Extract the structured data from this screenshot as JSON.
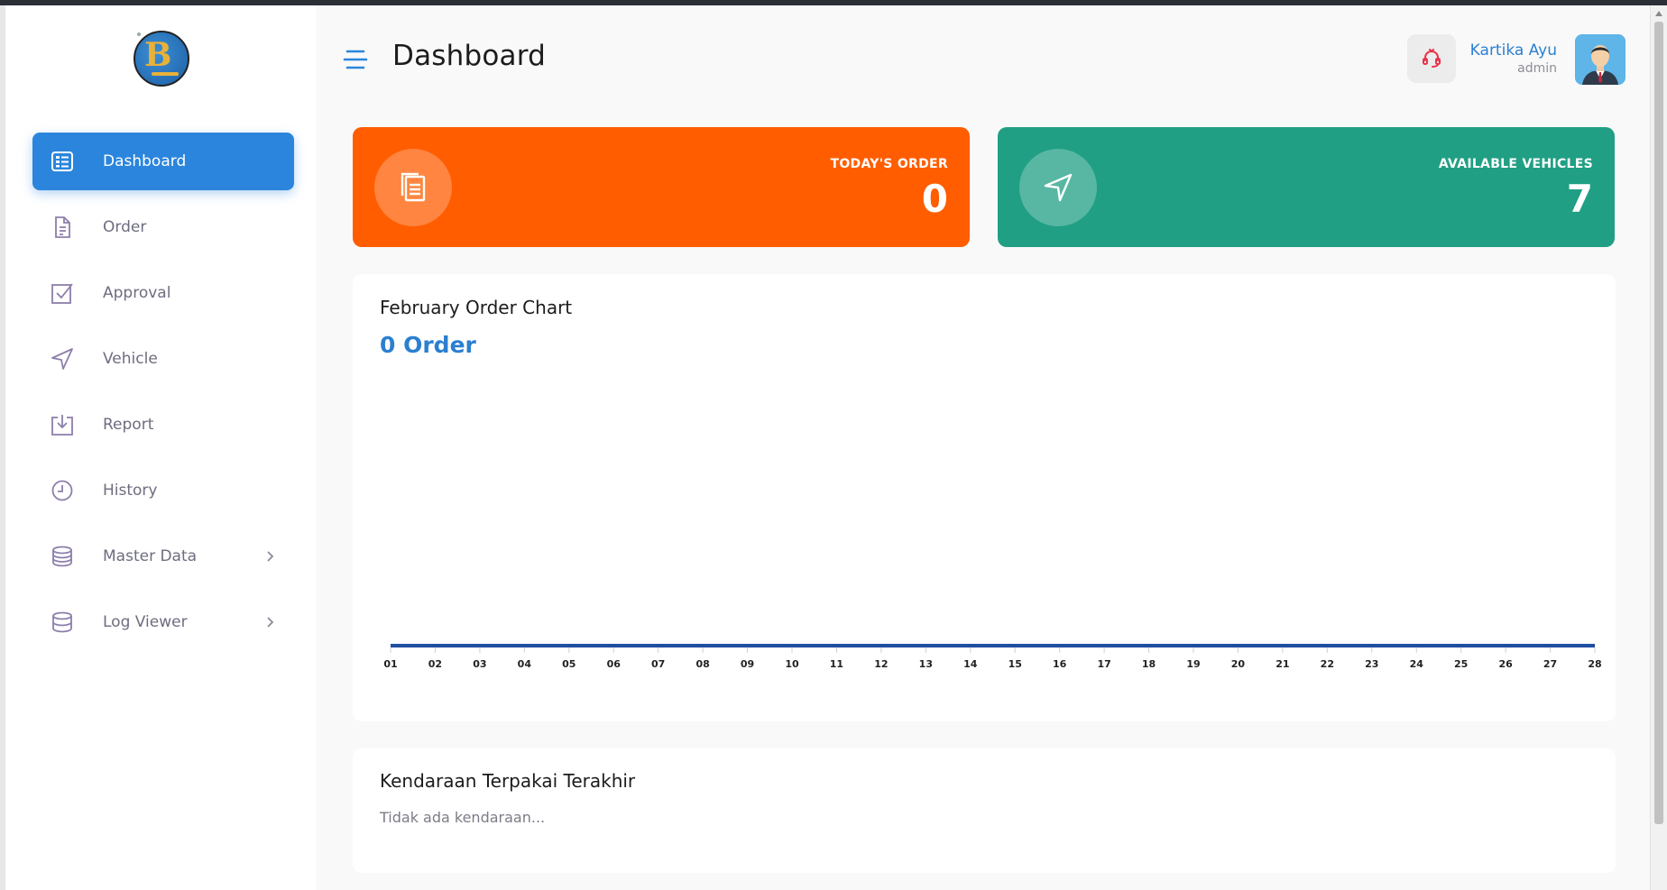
{
  "sidebar": {
    "items": [
      {
        "label": "Dashboard",
        "icon": "dashboard-icon",
        "active": true
      },
      {
        "label": "Order",
        "icon": "document-icon"
      },
      {
        "label": "Approval",
        "icon": "checkbox-icon"
      },
      {
        "label": "Vehicle",
        "icon": "navigation-arrow-icon"
      },
      {
        "label": "Report",
        "icon": "download-tray-icon"
      },
      {
        "label": "History",
        "icon": "clock-icon"
      },
      {
        "label": "Master Data",
        "icon": "database-icon",
        "has_children": true
      },
      {
        "label": "Log Viewer",
        "icon": "database-icon",
        "has_children": true
      }
    ]
  },
  "header": {
    "title": "Dashboard",
    "user_name": "Kartika Ayu",
    "user_role": "admin"
  },
  "stats": {
    "today_order": {
      "label": "TODAY'S ORDER",
      "value": "0"
    },
    "available_vehicles": {
      "label": "AVAILABLE VEHICLES",
      "value": "7"
    }
  },
  "chart_card": {
    "title": "February Order Chart",
    "subtitle": "0 Order"
  },
  "chart_data": {
    "type": "line",
    "categories": [
      "01",
      "02",
      "03",
      "04",
      "05",
      "06",
      "07",
      "08",
      "09",
      "10",
      "11",
      "12",
      "13",
      "14",
      "15",
      "16",
      "17",
      "18",
      "19",
      "20",
      "21",
      "22",
      "23",
      "24",
      "25",
      "26",
      "27",
      "28"
    ],
    "values": [
      0,
      0,
      0,
      0,
      0,
      0,
      0,
      0,
      0,
      0,
      0,
      0,
      0,
      0,
      0,
      0,
      0,
      0,
      0,
      0,
      0,
      0,
      0,
      0,
      0,
      0,
      0,
      0
    ],
    "grid": false,
    "color": "#1e4fa3"
  },
  "recent": {
    "title": "Kendaraan Terpakai Terakhir",
    "empty_text": "Tidak ada kendaraan..."
  },
  "colors": {
    "primary": "#2b85dd",
    "orange": "#ff5d00",
    "green": "#209f84",
    "notif_icon": "#e8334a"
  }
}
